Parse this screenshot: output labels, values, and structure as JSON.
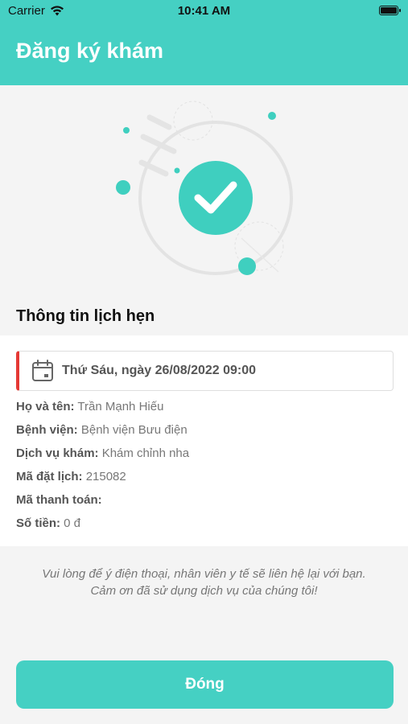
{
  "status_bar": {
    "carrier": "Carrier",
    "time": "10:41 AM",
    "icons": [
      "wifi-icon",
      "battery-icon"
    ]
  },
  "header": {
    "title": "Đăng ký khám"
  },
  "illustration": {
    "icon": "checkmark-circle-icon",
    "accent_color": "#3fcfbf"
  },
  "appointment": {
    "section_title": "Thông tin lịch hẹn",
    "date_icon": "calendar-icon",
    "datetime": "Thứ Sáu, ngày 26/08/2022 09:00",
    "fields": [
      {
        "label": "Họ và tên:",
        "value": "Trần Mạnh Hiếu"
      },
      {
        "label": "Bệnh viện:",
        "value": "Bệnh viện Bưu điện"
      },
      {
        "label": "Dịch vụ khám:",
        "value": "Khám chỉnh nha"
      },
      {
        "label": "Mã đặt lịch:",
        "value": "215082"
      },
      {
        "label": "Mã thanh toán:",
        "value": ""
      },
      {
        "label": "Số tiền:",
        "value": "0 đ"
      }
    ]
  },
  "note": {
    "line1": "Vui lòng để ý điện thoại, nhân viên y tế sẽ liên hệ lại với bạn.",
    "line2": "Cảm ơn đã sử dụng dịch vụ của chúng tôi!"
  },
  "actions": {
    "close_label": "Đóng"
  },
  "colors": {
    "primary": "#45d0c3",
    "accent_red": "#e53935"
  }
}
